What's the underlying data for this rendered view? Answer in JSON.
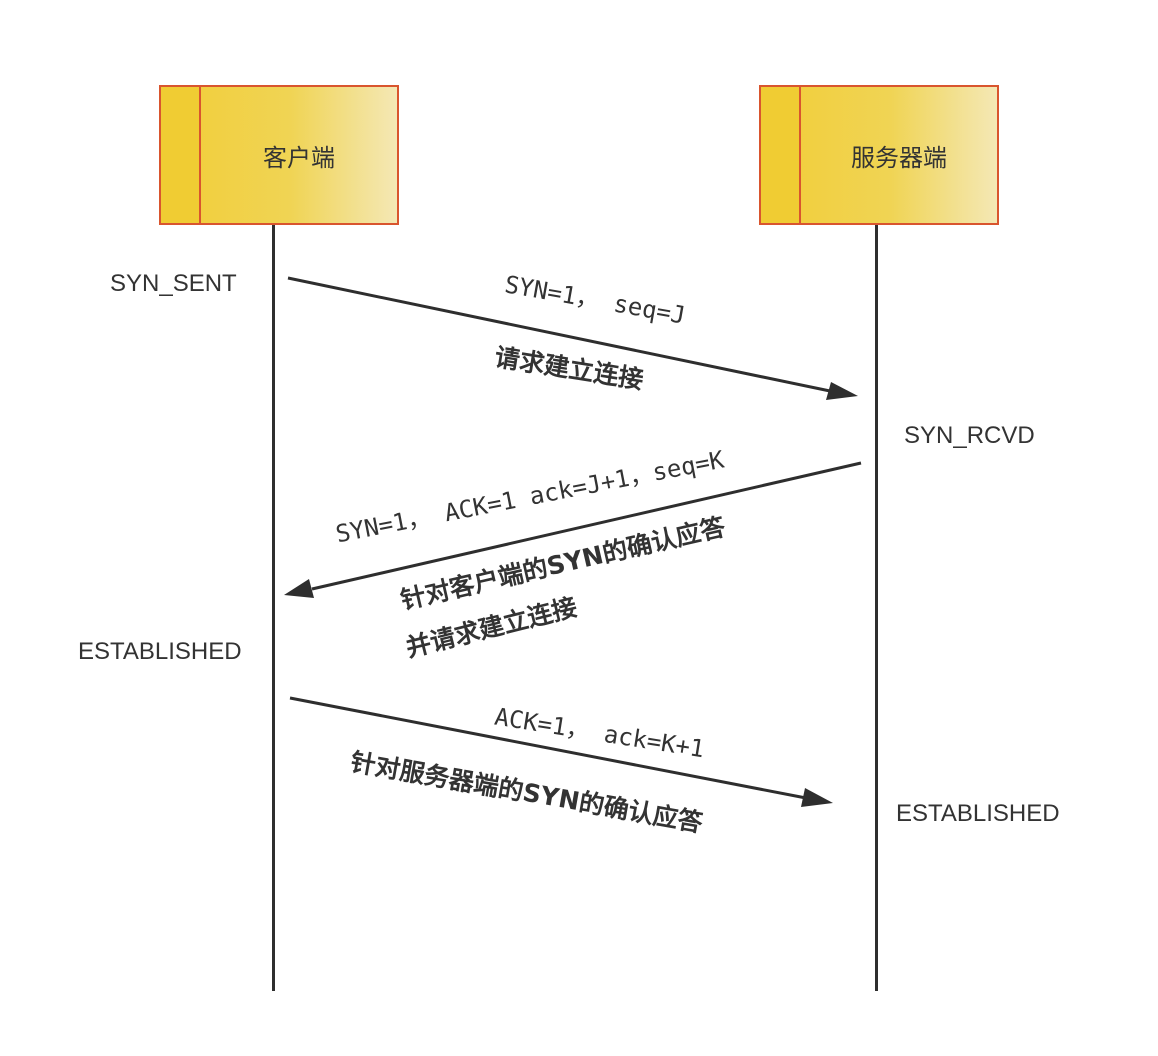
{
  "participants": {
    "client": "客户端",
    "server": "服务器端"
  },
  "states": {
    "client_syn_sent": "SYN_SENT",
    "server_syn_rcvd": "SYN_RCVD",
    "client_established": "ESTABLISHED",
    "server_established": "ESTABLISHED"
  },
  "messages": [
    {
      "flags": "SYN=1， seq=J",
      "description_lines": [
        "请求建立连接"
      ]
    },
    {
      "flags": "SYN=1， ACK=1  ack=J+1，seq=K",
      "description_lines": [
        "针对客户端的SYN的确认应答",
        "并请求建立连接"
      ]
    },
    {
      "flags": "ACK=1， ack=K+1",
      "description_lines": [
        "针对服务器端的SYN的确认应答"
      ]
    }
  ],
  "colors": {
    "box_border": "#d9552e",
    "box_fill": "#f0d454",
    "line": "#2e2e2e",
    "text": "#333333"
  }
}
